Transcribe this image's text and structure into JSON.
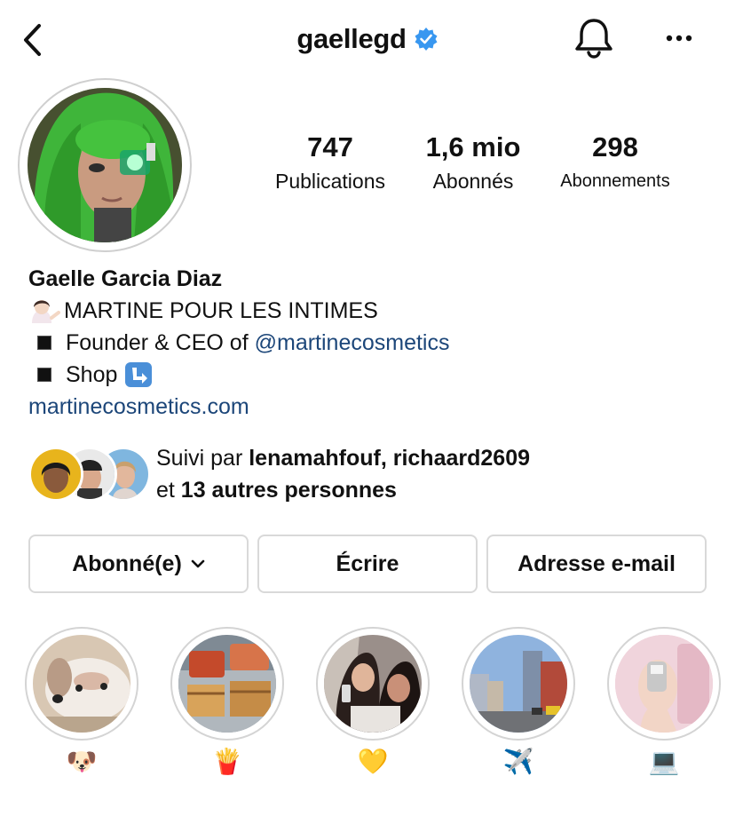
{
  "header": {
    "username": "gaellegd",
    "verified_icon": "verified-badge-icon",
    "back_icon": "chevron-left-icon",
    "bell_icon": "bell-icon",
    "more_icon": "more-horizontal-icon"
  },
  "stats": {
    "posts_value": "747",
    "posts_label": "Publications",
    "followers_value": "1,6 mio",
    "followers_label": "Abonnés",
    "following_value": "298",
    "following_label": "Abonnements"
  },
  "bio": {
    "name": "Gaelle Garcia Diaz",
    "line1": "MARTINE POUR LES INTIMES",
    "line2_text": "Founder & CEO of ",
    "line2_mention": "@martinecosmetics",
    "line3_text": "Shop",
    "website": "martinecosmetics.com"
  },
  "followed_by": {
    "prefix": "Suivi par ",
    "names": "lenamahfouf, richaard2609",
    "line2_prefix": "et ",
    "others": "13 autres personnes"
  },
  "buttons": {
    "follow_label": "Abonné(e)",
    "message_label": "Écrire",
    "email_label": "Adresse e-mail"
  },
  "highlights": [
    {
      "emoji": "🐶"
    },
    {
      "emoji": "🍟"
    },
    {
      "emoji": "💛"
    },
    {
      "emoji": "✈️"
    },
    {
      "emoji": "💻"
    }
  ],
  "colors": {
    "verified": "#3897f0",
    "link": "#1c4679",
    "border": "#d9d9d9"
  }
}
